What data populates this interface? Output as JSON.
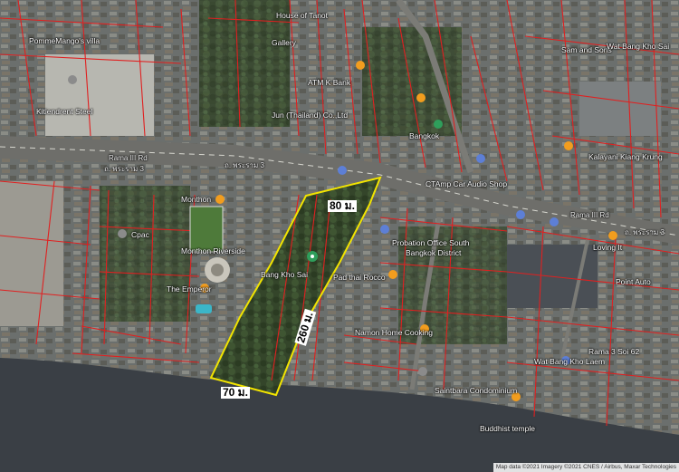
{
  "map": {
    "labels": {
      "house_of_tanot": "House of Tanot",
      "gallery": "Gallery",
      "pommemango": "PommeMango's villa",
      "atm_k_bank": "ATM K Bank",
      "jun_thailand": "Jun (Thailand) Co.,Ltd",
      "bangkok": "Bangkok",
      "rama3_rd": "Rama III Rd",
      "rama3_th": "ถ. พระราม 3",
      "rama3_rd_right": "Rama III Rd",
      "rama3_th_right": "ถ. พระราม 3",
      "cat_audio": "CTAmp Car Audio Shop",
      "monthon": "Monthon",
      "cpac": "Cpac",
      "monthon_riverside": "Monthon Riverside",
      "bang_kho_sai": "Bang Kho Sai",
      "the_emperor": "The Emperor",
      "probation": "Probation Office South",
      "bangkok_district": "Bangkok District",
      "pad_thai": "Pad thai Rocco",
      "namon_cooking": "Namon Home Cooking",
      "saintbara": "Saintbara Condominium",
      "wat_bang_kho": "Wat Bang Kho Laem",
      "buddhist_temple": "Buddhist temple",
      "loving_it": "Loving It",
      "point_auto": "Point Auto",
      "rama3_soi": "Rama 3 Soi 62",
      "kitiendrent": "Kitiendrent Steel",
      "kasikorn": "Kalayani Kiang Krung",
      "sam_and_sons": "Sam and Sons",
      "wat_bang_sai": "Wat Bang Kho Sai"
    },
    "dimensions": {
      "top": "80 ม.",
      "right": "260 ม.",
      "bottom": "70 ม."
    },
    "attribution": "Map data ©2021 Imagery ©2021 CNES / Airbus, Maxar Technologies",
    "colors": {
      "parcel": "#e02020",
      "outline": "#f2e400",
      "river": "#3a3f45",
      "road": "#6e6e6a",
      "pin_orange": "#f29d1e",
      "pin_blue": "#5d7fd6",
      "pin_green": "#2f9e5b",
      "pin_gray": "#8b8b8b"
    }
  }
}
